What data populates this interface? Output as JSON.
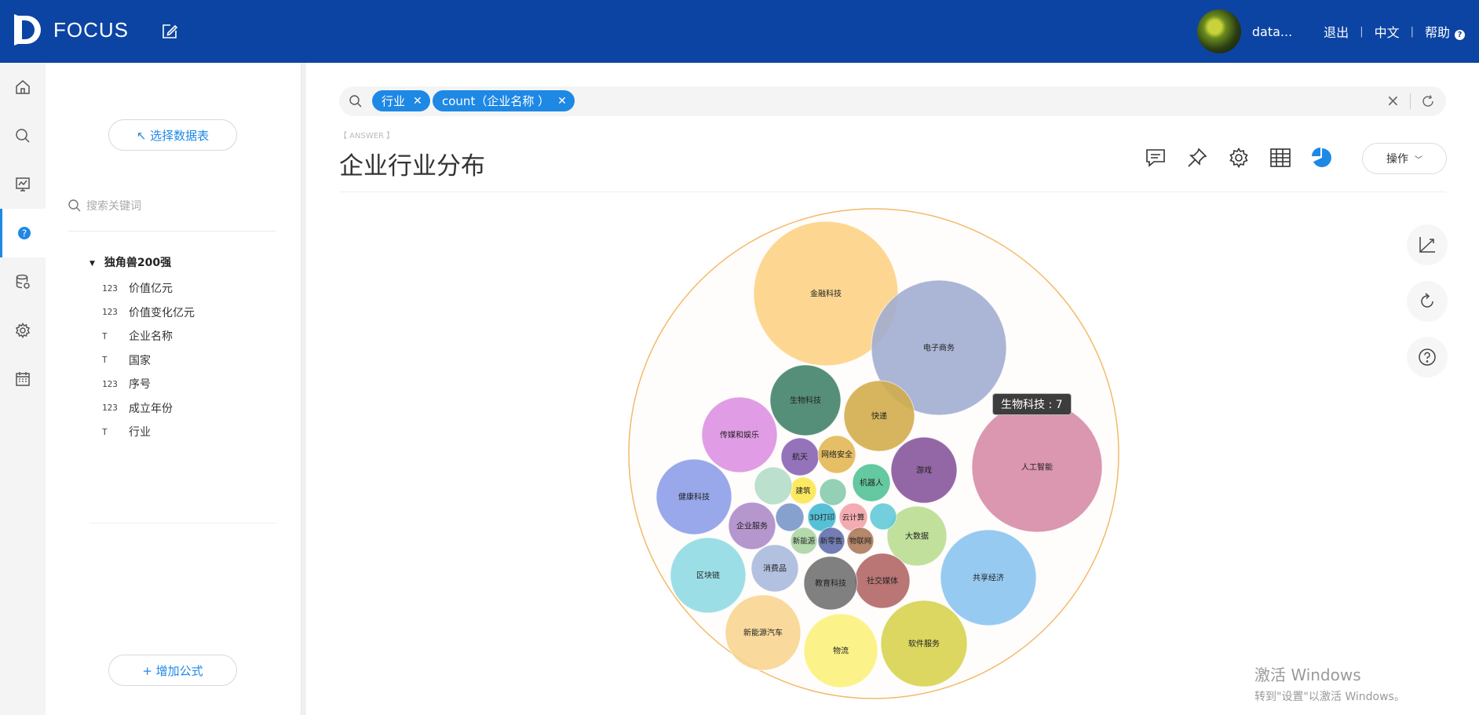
{
  "header": {
    "app_name": "FOCUS",
    "user_name": "data...",
    "logout": "退出",
    "language": "中文",
    "help": "帮助",
    "help_badge": "?"
  },
  "rail": {
    "items": [
      "home-icon",
      "search-icon",
      "dashboard-icon",
      "question-icon",
      "database-icon",
      "gear-icon",
      "calendar-icon"
    ],
    "active": "question-icon"
  },
  "panel": {
    "select_table": "↖ 选择数据表",
    "search_placeholder": "搜索关键词",
    "table_name": "独角兽200强",
    "fields": [
      {
        "type": "123",
        "name": "价值亿元"
      },
      {
        "type": "123",
        "name": "价值变化亿元"
      },
      {
        "type": "T",
        "name": "企业名称"
      },
      {
        "type": "T",
        "name": "国家"
      },
      {
        "type": "123",
        "name": "序号"
      },
      {
        "type": "123",
        "name": "成立年份"
      },
      {
        "type": "T",
        "name": "行业"
      }
    ],
    "add_formula": "+ 增加公式"
  },
  "search": {
    "chips": [
      "行业",
      "count（企业名称 ）"
    ],
    "clear": "×"
  },
  "answer": {
    "tag": "【 ANSWER 】",
    "title": "企业行业分布",
    "operate": "操作"
  },
  "tooltip": "生物科技 : 7",
  "chart_data": {
    "type": "bubble-pack",
    "category_field": "行业",
    "value_field": "count（企业名称 ）",
    "bubbles": [
      {
        "label": "金融科技",
        "color": "#fdd283"
      },
      {
        "label": "电子商务",
        "color": "#9facd0"
      },
      {
        "label": "人工智能",
        "color": "#d688a5"
      },
      {
        "label": "共享经济",
        "color": "#89c3ef"
      },
      {
        "label": "软件服务",
        "color": "#d6d14a"
      },
      {
        "label": "物流",
        "color": "#fbf17a"
      },
      {
        "label": "新能源汽车",
        "color": "#f8d48e"
      },
      {
        "label": "区块链",
        "color": "#8dd9e2"
      },
      {
        "label": "健康科技",
        "color": "#8b9ce8"
      },
      {
        "label": "传媒和娱乐",
        "color": "#dc8ee0"
      },
      {
        "label": "生物科技",
        "value": 7,
        "color": "#3d8066"
      },
      {
        "label": "快递",
        "color": "#d1ab49"
      },
      {
        "label": "游戏",
        "color": "#845299"
      },
      {
        "label": "大数据",
        "color": "#b7dc8e"
      },
      {
        "label": "社交媒体",
        "color": "#b06262"
      },
      {
        "label": "教育科技",
        "color": "#6e6e6e"
      },
      {
        "label": "消费品",
        "color": "#a9b8dc"
      },
      {
        "label": "企业服务",
        "color": "#ab87c6"
      },
      {
        "label": "航天",
        "color": "#8660b0"
      },
      {
        "label": "网络安全",
        "color": "#e1b550"
      },
      {
        "label": "机器人",
        "color": "#4ec093"
      },
      {
        "label": "建筑",
        "color": "#fae64c"
      },
      {
        "label": "",
        "color": "#b2dcc6"
      },
      {
        "label": "",
        "color": "#84c9ac"
      },
      {
        "label": "",
        "color": "#7694c7"
      },
      {
        "label": "3D打印",
        "color": "#3fb8d0"
      },
      {
        "label": "云计算",
        "color": "#f1a0a6"
      },
      {
        "label": "",
        "color": "#5fc8d6"
      },
      {
        "label": "新能源",
        "color": "#a9d4a2"
      },
      {
        "label": "新零售",
        "color": "#5d6ba8"
      },
      {
        "label": "物联网",
        "color": "#ab7656"
      }
    ]
  },
  "watermark": {
    "line1": "激活 Windows",
    "line2": "转到\"设置\"以激活 Windows。"
  }
}
